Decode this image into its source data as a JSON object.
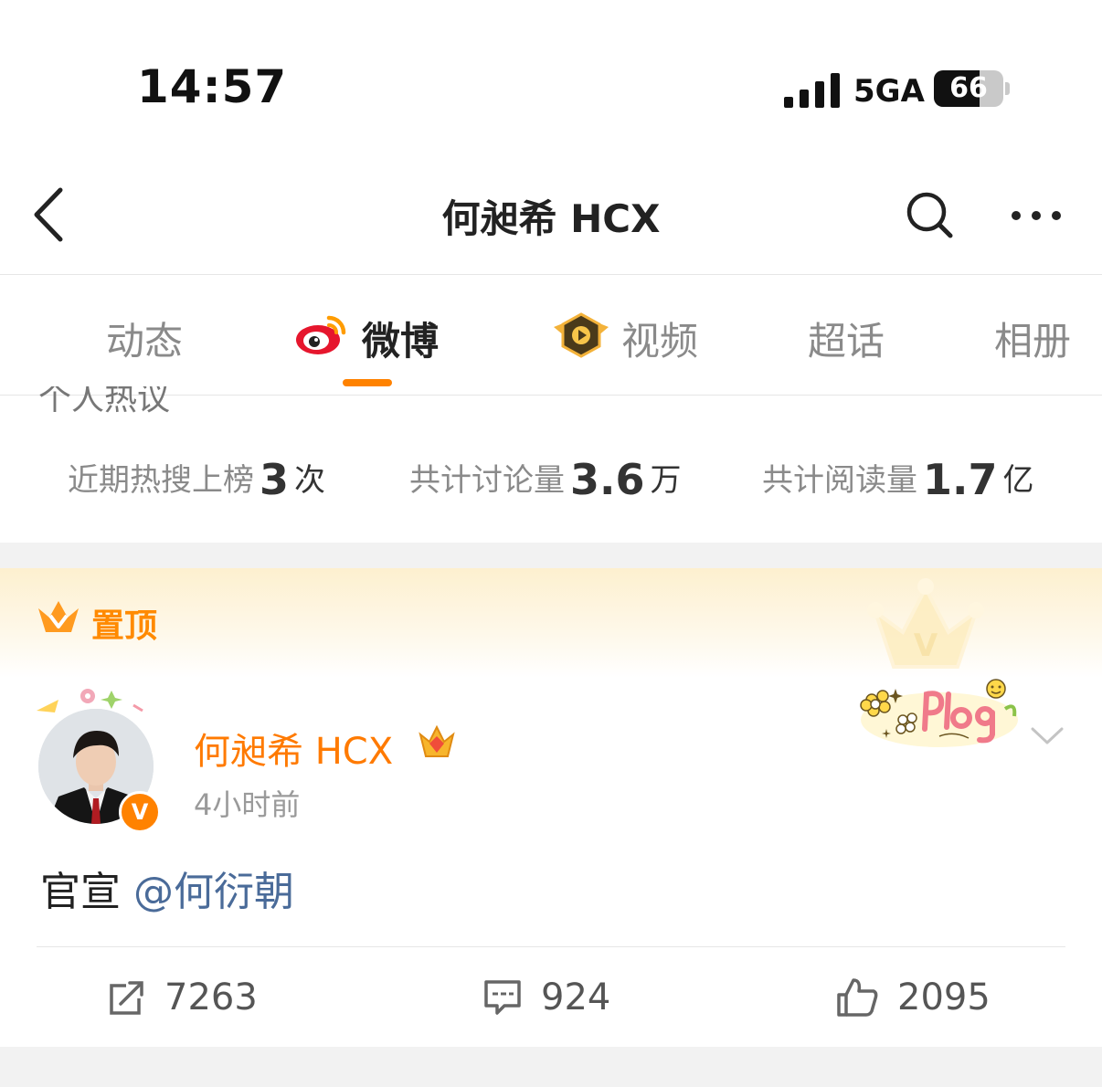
{
  "status_bar": {
    "time": "14:57",
    "network": "5GA",
    "battery_level": "66",
    "battery_fraction": 0.66
  },
  "header": {
    "title": "何昶希 HCX",
    "icons": [
      "back-icon",
      "search-icon",
      "more-icon"
    ]
  },
  "tabs": [
    {
      "label": "动态",
      "active": false
    },
    {
      "label": "微博",
      "active": true,
      "icon": "weibo-logo-icon"
    },
    {
      "label": "视频",
      "active": false,
      "icon": "video-icon"
    },
    {
      "label": "超话",
      "active": false
    },
    {
      "label": "相册",
      "active": false
    }
  ],
  "hot": {
    "section_label": "个人热议",
    "stats": [
      {
        "label": "近期热搜上榜",
        "value": "3",
        "unit": "次"
      },
      {
        "label": "共计讨论量",
        "value": "3.6",
        "unit": "万"
      },
      {
        "label": "共计阅读量",
        "value": "1.7",
        "unit": "亿"
      }
    ]
  },
  "pinned": {
    "label": "置顶"
  },
  "post": {
    "author": "何昶希 HCX",
    "time": "4小时前",
    "verified_badge": "V",
    "content_text": "官宣",
    "mention": "@何衍朝",
    "actions": [
      {
        "icon": "repost-icon",
        "count": "7263"
      },
      {
        "icon": "comment-icon",
        "count": "924"
      },
      {
        "icon": "like-icon",
        "count": "2095"
      }
    ]
  },
  "colors": {
    "accent": "#ff8200",
    "mention": "#4a6b99",
    "pinned_label": "#ff8a00"
  }
}
